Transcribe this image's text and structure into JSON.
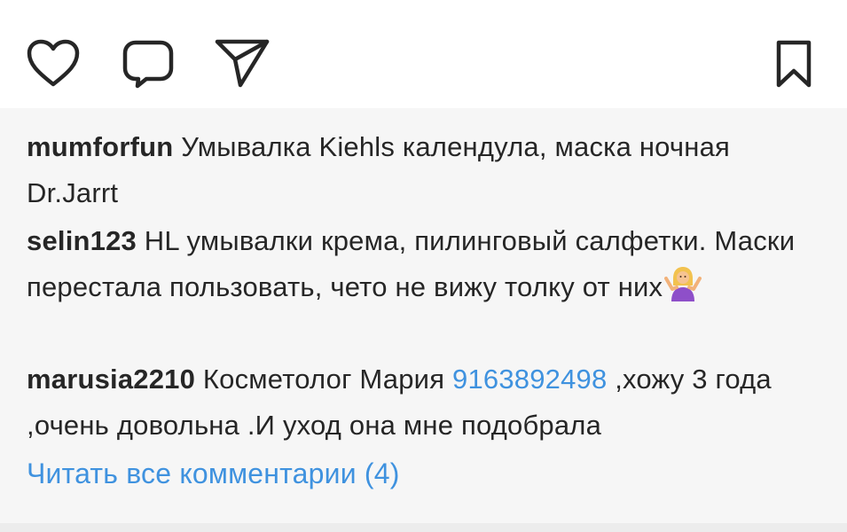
{
  "actions": {
    "icons": [
      "heart-icon",
      "comment-bubble-icon",
      "paper-plane-icon",
      "bookmark-icon"
    ]
  },
  "comments": [
    {
      "username": "mumforfun",
      "text": "Умывалка Kiehls календула, маска ночная Dr.Jarrt"
    },
    {
      "username": "selin123",
      "text": "HL умывалки крема, пилинговый салфетки. Маски перестала пользовать, чето не вижу толку от них",
      "emoji": "person-shrugging-emoji"
    },
    {
      "username": "marusia2210",
      "text_before": "Косметолог Мария ",
      "phone": "9163892498",
      "text_after": " ,хожу 3 года ,очень довольна .И уход она мне подобрала"
    }
  ],
  "view_all_label": "Читать все комментарии (4)",
  "colors": {
    "text": "#262626",
    "link": "#3f92df",
    "comments_background": "#f6f6f6",
    "icon_stroke": "#262626"
  }
}
